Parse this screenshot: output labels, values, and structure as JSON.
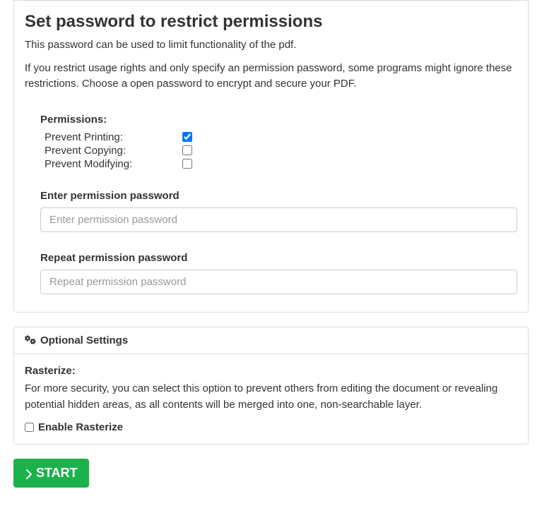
{
  "restrict": {
    "heading": "Set password to restrict permissions",
    "desc1": "This password can be used to limit functionality of the pdf.",
    "desc2": "If you restrict usage rights and only specify an permission password, some programs might ignore these restrictions. Choose a open password to encrypt and secure your PDF.",
    "permissions_label": "Permissions:",
    "prevent_printing_label": "Prevent Printing:",
    "prevent_printing_checked": true,
    "prevent_copying_label": "Prevent Copying:",
    "prevent_copying_checked": false,
    "prevent_modifying_label": "Prevent Modifying:",
    "prevent_modifying_checked": false,
    "enter_pw_label": "Enter permission password",
    "enter_pw_placeholder": "Enter permission password",
    "repeat_pw_label": "Repeat permission password",
    "repeat_pw_placeholder": "Repeat permission password"
  },
  "optional": {
    "heading": "Optional Settings",
    "rasterize_label": "Rasterize:",
    "rasterize_desc": "For more security, you can select this option to prevent others from editing the document or revealing potential hidden areas, as all contents will be merged into one, non-searchable layer.",
    "enable_rasterize_label": "Enable Rasterize",
    "enable_rasterize_checked": false
  },
  "start_button": "START"
}
